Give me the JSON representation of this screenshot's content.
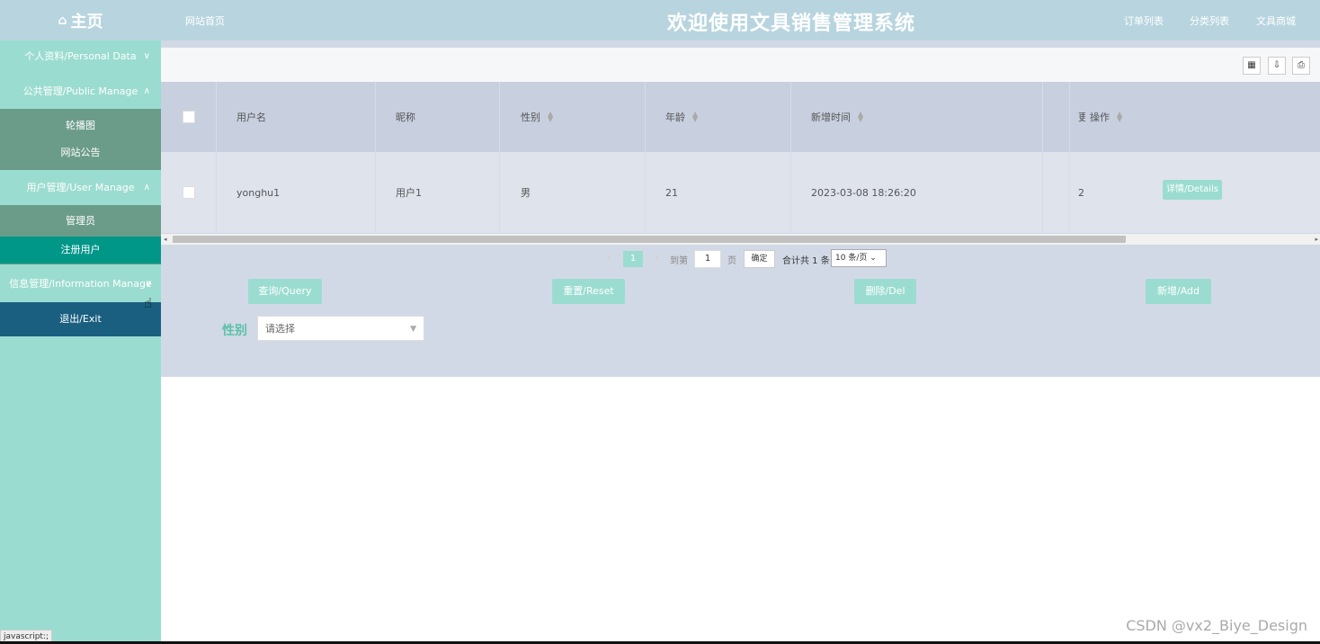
{
  "header": {
    "home_label": "主页",
    "home_icon": "home-icon",
    "nav_home": "网站首页",
    "title": "欢迎使用文具销售管理系统",
    "links": [
      "订单列表",
      "分类列表",
      "文具商城"
    ]
  },
  "sidebar": {
    "personal": "个人资料/Personal Data",
    "public": "公共管理/Public Manage",
    "public_items": [
      "轮播图",
      "网站公告"
    ],
    "user": "用户管理/User Manage",
    "user_items": [
      "管理员",
      "注册用户"
    ],
    "info": "信息管理/Information Manage",
    "exit": "退出/Exit"
  },
  "colors": {
    "header_bg": "#b8d5df",
    "sidebar_bg": "#9bdcd0",
    "submenu_bg": "#6b9c8a",
    "active_bg": "#009688",
    "exit_bg": "#1b5f80",
    "accent": "#9bdcd0"
  },
  "table": {
    "headers": [
      "用户名",
      "昵称",
      "性别",
      "年龄",
      "新增时间",
      "更",
      "操作"
    ],
    "rows": [
      {
        "username": "yonghu1",
        "nickname": "用户1",
        "gender": "男",
        "age": "21",
        "created": "2023-03-08 18:26:20",
        "extra": "2",
        "action": "详情/Details"
      }
    ]
  },
  "pager": {
    "current": "1",
    "goto_label": "到第",
    "page_input": "1",
    "page_unit": "页",
    "confirm": "确定",
    "total": "合计共 1 条",
    "size": "10 条/页"
  },
  "actions": {
    "query": "查询/Query",
    "reset": "重置/Reset",
    "delete": "删除/Del",
    "add": "新增/Add"
  },
  "filter": {
    "label": "性别",
    "placeholder": "请选择"
  },
  "toolbar_icons": [
    "columns-icon",
    "export-icon",
    "print-icon"
  ],
  "watermark": "CSDN @vx2_Biye_Design",
  "status": "javascript:;"
}
